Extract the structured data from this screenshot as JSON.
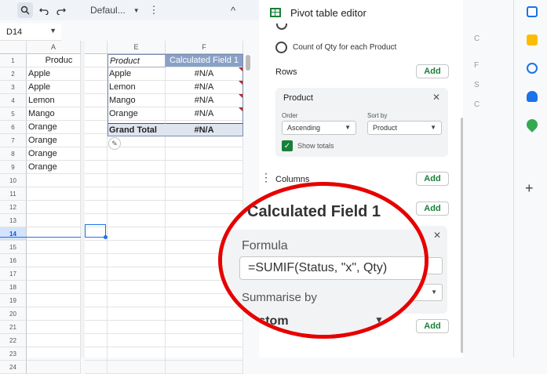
{
  "toolbar": {
    "search_icon": "search-icon",
    "undo_icon": "undo-icon",
    "redo_icon": "redo-icon",
    "font_select": "Defaul...",
    "more_label": "⋮",
    "collapse_label": "^"
  },
  "name_box": {
    "value": "D14"
  },
  "grid": {
    "col_a": "A",
    "col_e": "E",
    "col_f": "F",
    "rows": [
      "1",
      "2",
      "3",
      "4",
      "5",
      "6",
      "7",
      "8",
      "9",
      "10",
      "11",
      "12",
      "13",
      "14",
      "15",
      "16",
      "17",
      "18",
      "19",
      "20",
      "21",
      "22",
      "23",
      "24"
    ],
    "col_a_values": [
      "Produc",
      "Apple",
      "Apple",
      "Lemon",
      "Mango",
      "Orange",
      "Orange",
      "Orange",
      "Orange"
    ],
    "pivot": {
      "header": [
        "Product",
        "Calculated Field 1"
      ],
      "rows": [
        [
          "Apple",
          "#N/A"
        ],
        [
          "Lemon",
          "#N/A"
        ],
        [
          "Mango",
          "#N/A"
        ],
        [
          "Orange",
          "#N/A"
        ]
      ],
      "total": [
        "Grand Total",
        "#N/A"
      ]
    },
    "selected_row": "14"
  },
  "panel": {
    "title": "Pivot table editor",
    "count_option": "Count of Qty for each Product",
    "rows_label": "Rows",
    "add": "Add",
    "product_card": {
      "title": "Product",
      "order_label": "Order",
      "order_value": "Ascending",
      "sort_label": "Sort by",
      "sort_value": "Product",
      "show_totals": "Show totals"
    },
    "columns_label": "Columns",
    "calc_field_title": "Calculated Field 1",
    "formula_label": "Formula",
    "formula_value": "=SUMIF(Status, \"x\", Qty)",
    "summarise_label": "Summarise by",
    "summarise_value": "Custom"
  },
  "strip": {
    "letters": [
      "C",
      "F",
      "S",
      "C"
    ]
  },
  "colors": {
    "accent": "#188038",
    "highlight": "#e60000",
    "selection": "#1a73e8"
  }
}
